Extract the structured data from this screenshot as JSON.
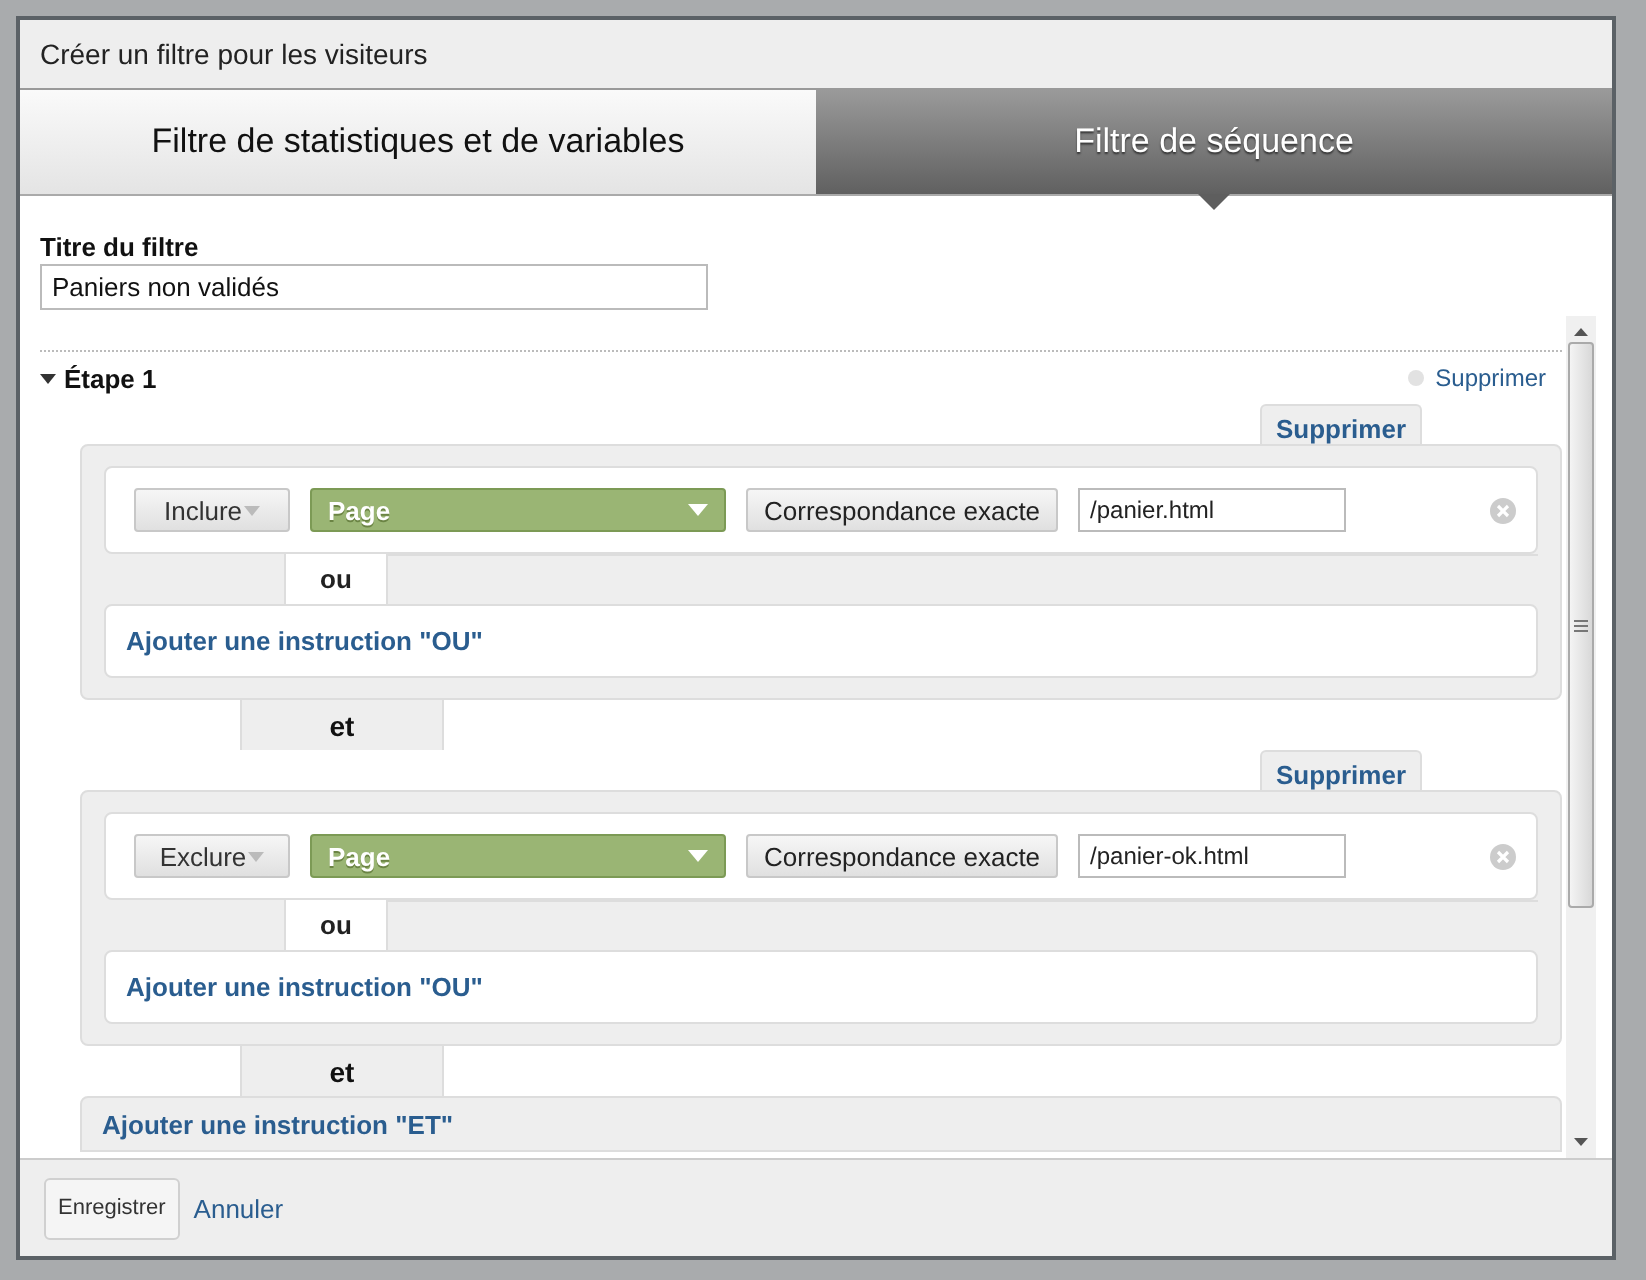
{
  "dialog": {
    "title": "Créer un filtre pour les visiteurs"
  },
  "tabs": [
    {
      "label": "Filtre de statistiques et de variables",
      "selected": false
    },
    {
      "label": "Filtre de séquence",
      "selected": true
    }
  ],
  "filter_title": {
    "label": "Titre du filtre",
    "value": "Paniers non validés"
  },
  "step": {
    "label": "Étape 1",
    "expanded": true,
    "delete_link": "Supprimer",
    "conditions": [
      {
        "delete_tab": "Supprimer",
        "mode": "Inclure",
        "dimension": "Page",
        "match": "Correspondance exacte",
        "value": "/panier.html",
        "or_label": "ou",
        "add_or": "Ajouter une instruction \"OU\"",
        "and_label": "et"
      },
      {
        "delete_tab": "Supprimer",
        "mode": "Exclure",
        "dimension": "Page",
        "match": "Correspondance exacte",
        "value": "/panier-ok.html",
        "or_label": "ou",
        "add_or": "Ajouter une instruction \"OU\"",
        "and_label": "et"
      }
    ],
    "add_and": "Ajouter une instruction \"ET\""
  },
  "footer": {
    "save": "Enregistrer",
    "cancel": "Annuler"
  }
}
